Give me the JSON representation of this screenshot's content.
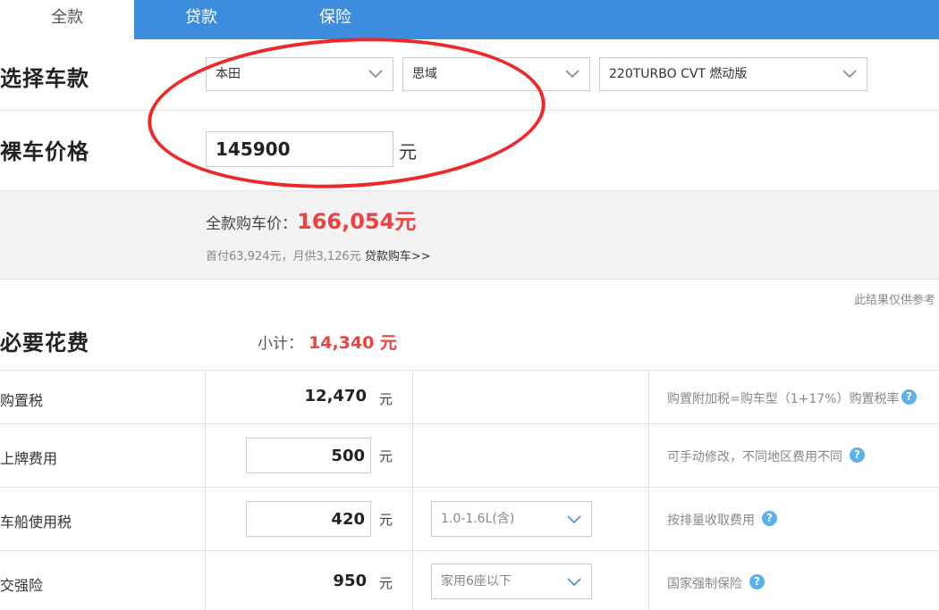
{
  "tabs": [
    {
      "label": "全款",
      "active": true
    },
    {
      "label": "贷款",
      "active": false
    },
    {
      "label": "保险",
      "active": false
    }
  ],
  "car_select": {
    "label": "选择车款",
    "brand": "本田",
    "series": "思域",
    "model": "220TURBO CVT 燃动版"
  },
  "price": {
    "label": "裸车价格",
    "value": "145900",
    "unit": "元"
  },
  "summary": {
    "total_label": "全款购车价：",
    "total_value": "166,054元",
    "detail": "首付63,924元，月供3,126元",
    "loan_link": "贷款购车>>"
  },
  "disclaimer": "此结果仅供参考",
  "required": {
    "label": "必要花费",
    "subtotal_label": "小计：",
    "subtotal_value": "14,340 元",
    "rows": [
      {
        "label": "购置税",
        "amount": "12,470",
        "unit": "元",
        "option": "",
        "note": "购置附加税=购车型（1+17%）购置税率"
      },
      {
        "label": "上牌费用",
        "amount": "500",
        "unit": "元",
        "option": "",
        "note": "可手动修改，不同地区费用不同"
      },
      {
        "label": "车船使用税",
        "amount": "420",
        "unit": "元",
        "option": "1.0-1.6L(含)",
        "note": "按排量收取费用"
      },
      {
        "label": "交强险",
        "amount": "950",
        "unit": "元",
        "option": "家用6座以下",
        "note": "国家强制保险"
      }
    ]
  },
  "help_glyph": "?",
  "colors": {
    "tab_bar": "#3d8ddf",
    "accent_red": "#f04141",
    "annotation_circle": "#ee2828",
    "help_icon": "#5ab2e8"
  }
}
